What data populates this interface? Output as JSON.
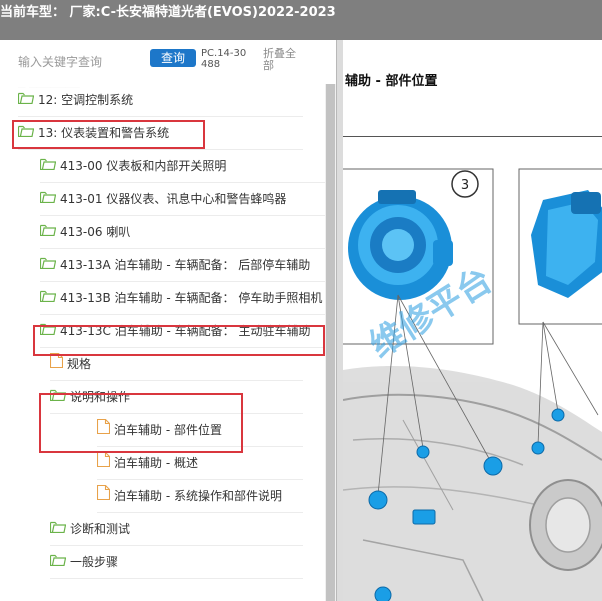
{
  "header": {
    "title": "当前车型： 厂家:C-长安福特道光者(EVOS)2022-2023"
  },
  "search": {
    "placeholder": "输入关键字查询",
    "button_label": "查询",
    "pc_code": "PC.14-30488",
    "collapse_label": "折叠全部"
  },
  "tree": {
    "items": [
      {
        "label": "12: 空调控制系统",
        "icon": "folder-open-icon"
      },
      {
        "label": "13: 仪表装置和警告系统",
        "icon": "folder-open-icon"
      },
      {
        "label": "413-00 仪表板和内部开关照明",
        "icon": "folder-open-icon"
      },
      {
        "label": "413-01 仪器仪表、讯息中心和警告蜂鸣器",
        "icon": "folder-open-icon"
      },
      {
        "label": "413-06 喇叭",
        "icon": "folder-open-icon"
      },
      {
        "label": "413-13A 泊车辅助 - 车辆配备： 后部停车辅助",
        "icon": "folder-open-icon"
      },
      {
        "label": "413-13B 泊车辅助 - 车辆配备： 停车助手照相机",
        "icon": "folder-open-icon"
      },
      {
        "label": "413-13C 泊车辅助 - 车辆配备： 主动驻车辅助",
        "icon": "folder-open-icon"
      },
      {
        "label": "规格",
        "icon": "document-icon"
      },
      {
        "label": "说明和操作",
        "icon": "folder-open-icon"
      },
      {
        "label": "泊车辅助 - 部件位置",
        "icon": "document-icon"
      },
      {
        "label": "泊车辅助 - 概述",
        "icon": "document-icon"
      },
      {
        "label": "泊车辅助 - 系统操作和部件说明",
        "icon": "document-icon"
      },
      {
        "label": "诊断和测试",
        "icon": "folder-open-icon"
      },
      {
        "label": "一般步骤",
        "icon": "folder-open-icon"
      }
    ]
  },
  "document": {
    "title": "辅助 - 部件位置",
    "callout_number": "3",
    "watermark_text": "维修平台"
  },
  "colors": {
    "accent": "#1d77c9",
    "highlight": "#d9363e",
    "folder": "#6bb34a",
    "doc_icon": "#e8a24a",
    "sensor_blue": "#1a9ee6"
  }
}
